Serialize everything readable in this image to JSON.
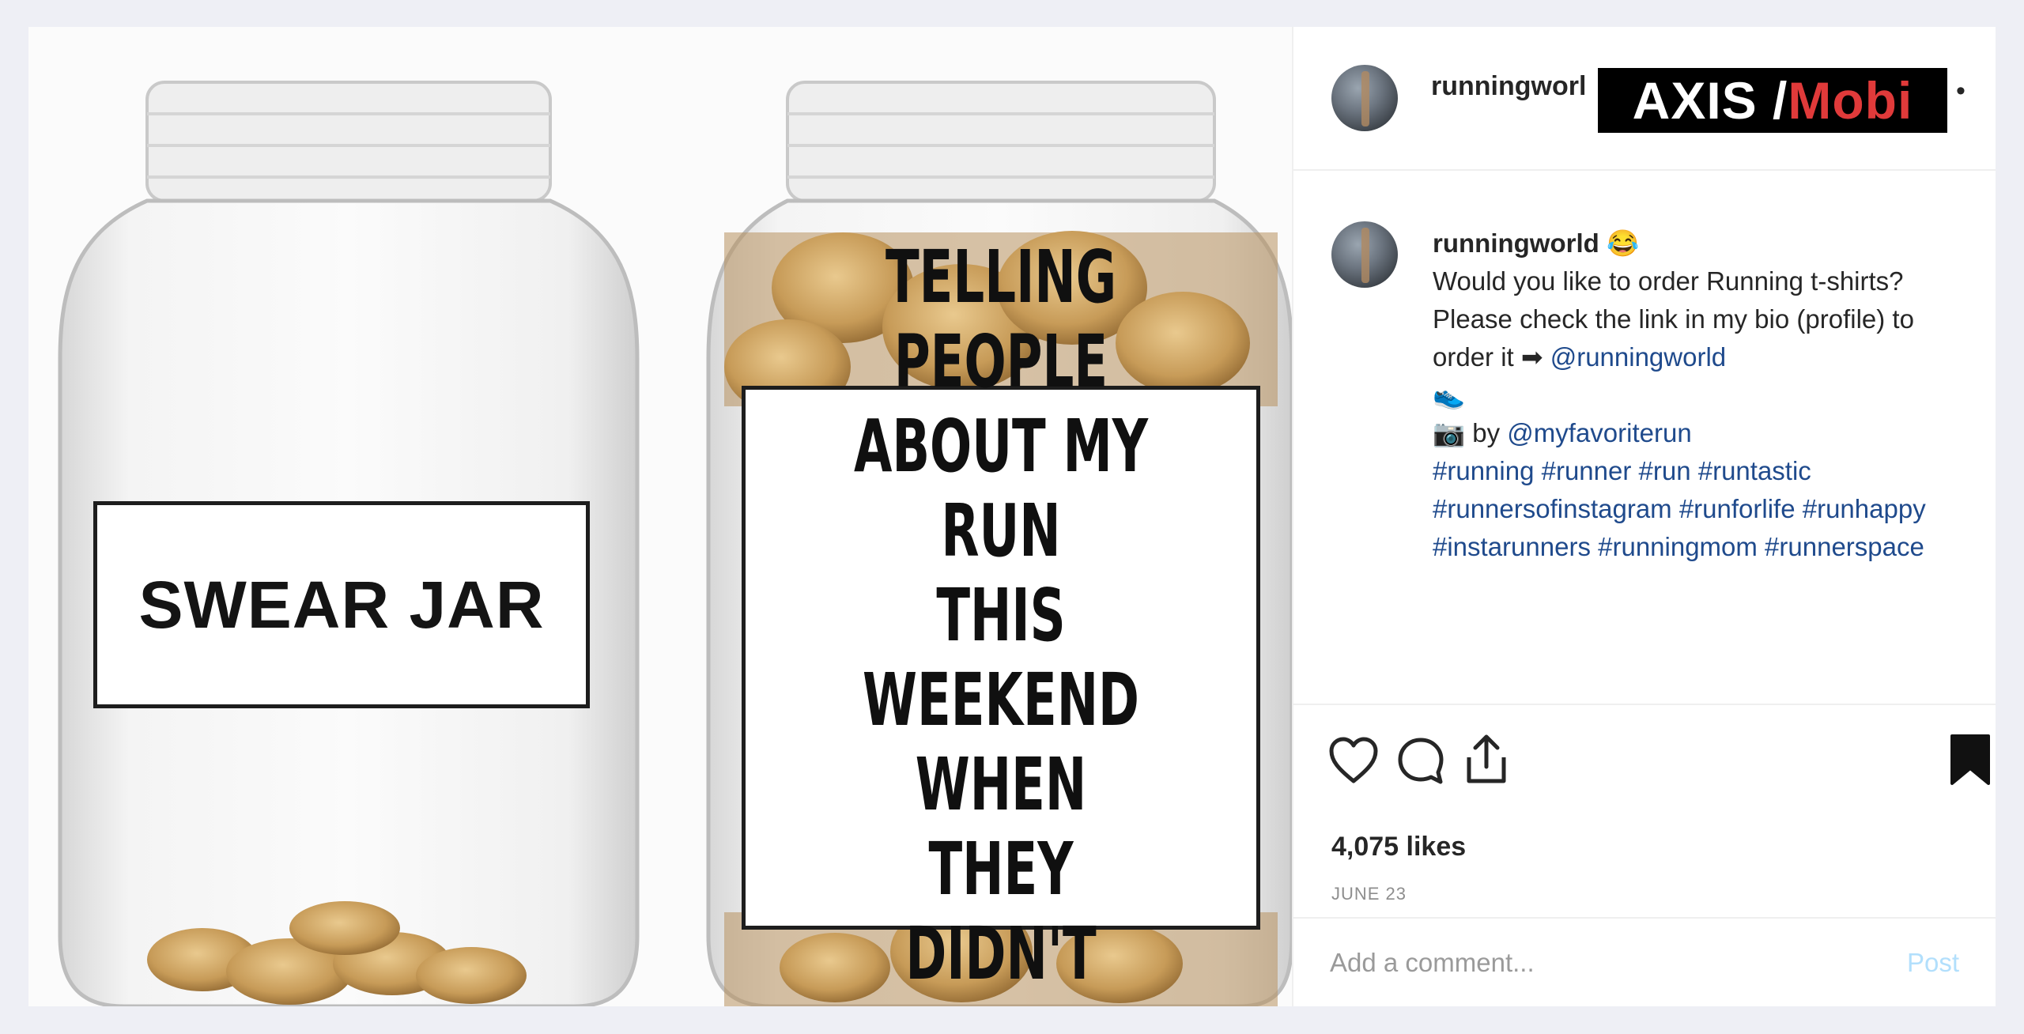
{
  "media": {
    "left_label": "SWEAR JAR",
    "right_label": "TELLING PEOPLE\nABOUT MY RUN\nTHIS WEEKEND\nWHEN THEY\nDIDN'T ASK"
  },
  "header": {
    "username": "runningworl",
    "more": "•",
    "watermark_part1": "AXIS / ",
    "watermark_part2": "Mobi"
  },
  "caption": {
    "username": "runningworld",
    "emoji": "😂",
    "line1": "Would you like to order Running t-shirts?",
    "line2_text": "Please check the link in my bio (profile) to order it ➡ ",
    "line2_link": "@runningworld",
    "line3_emoji": "👟",
    "credit_prefix": "📷 by ",
    "credit_link": "@myfavoriterun",
    "hashtags": "#running #runner #run #runtastic #runnersofinstagram #runforlife #runhappy #instarunners #runningmom #runnerspace"
  },
  "actions": {
    "icons": [
      "heart-icon",
      "comment-icon",
      "share-icon",
      "bookmark-icon"
    ],
    "likes": "4,075 likes",
    "date": "JUNE 23"
  },
  "comment": {
    "placeholder": "Add a comment...",
    "post_label": "Post"
  },
  "colors": {
    "link": "#1f4a8c",
    "post_button": "#b2dffc",
    "watermark_accent": "#e03a3a"
  }
}
